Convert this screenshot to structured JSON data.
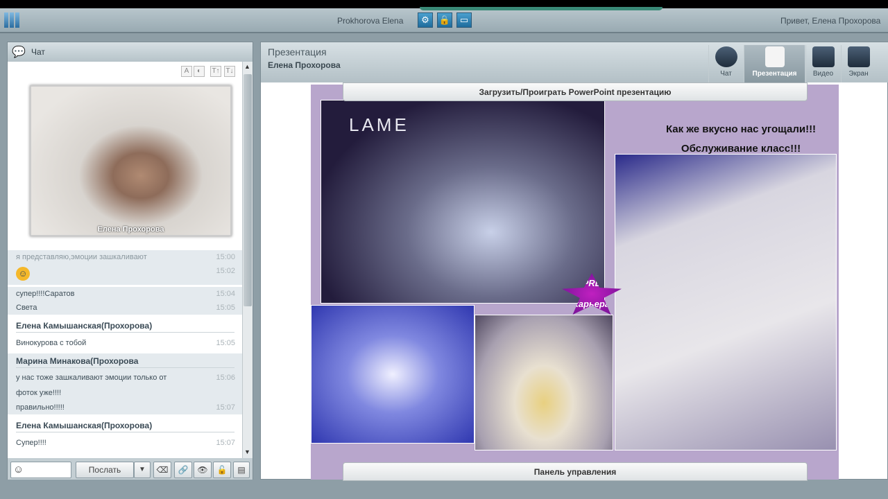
{
  "topbar": {
    "username": "Prokhorova Elena",
    "greeting": "Привет, Елена Прохорова",
    "icons": [
      "gear-icon",
      "lock-icon",
      "window-icon"
    ]
  },
  "chat": {
    "title": "Чат",
    "font_buttons": [
      "A",
      "◐",
      "T↑",
      "T↓"
    ],
    "video_name": "Елена Прохорова",
    "messages": [
      {
        "text": "я представляю,эмоции зашкаливают",
        "time": "15:00"
      },
      {
        "text": "😊",
        "time": "15:02",
        "emoji": "smile"
      },
      {
        "text": "супер!!!!Саратов",
        "time": "15:04"
      },
      {
        "text": "Света",
        "time": "15:05"
      },
      {
        "sender": "Елена Камышанская(Прохорова)"
      },
      {
        "text": "Винокурова с тобой",
        "time": "15:05"
      },
      {
        "sender": "Марина Минакова(Прохорова"
      },
      {
        "text": "у нас тоже зашкаливают эмоции только от",
        "time": "15:06"
      },
      {
        "text": "фоток уже!!!!"
      },
      {
        "text": "правильно!!!!!",
        "time": "15:07"
      },
      {
        "sender": "Елена Камышанская(Прохорова)"
      },
      {
        "text": "Супер!!!!",
        "time": "15:07"
      }
    ],
    "send_label": "Послать",
    "input_value": ""
  },
  "main": {
    "title": "Презентация",
    "subtitle": "Елена Прохорова",
    "modes": [
      {
        "label": "Чат"
      },
      {
        "label": "Презентация",
        "active": true
      },
      {
        "label": "Видео"
      },
      {
        "label": "Экран"
      }
    ],
    "upload_label": "Загрузить/Проиграть PowerPoint презентацию",
    "control_label": "Панель управления",
    "slide": {
      "line1": "Как же вкусно нас угощали!!!",
      "line2": "Обслуживание класс!!!",
      "logo_text": "LAME",
      "badge_text": "EXPRESS карьера"
    }
  }
}
